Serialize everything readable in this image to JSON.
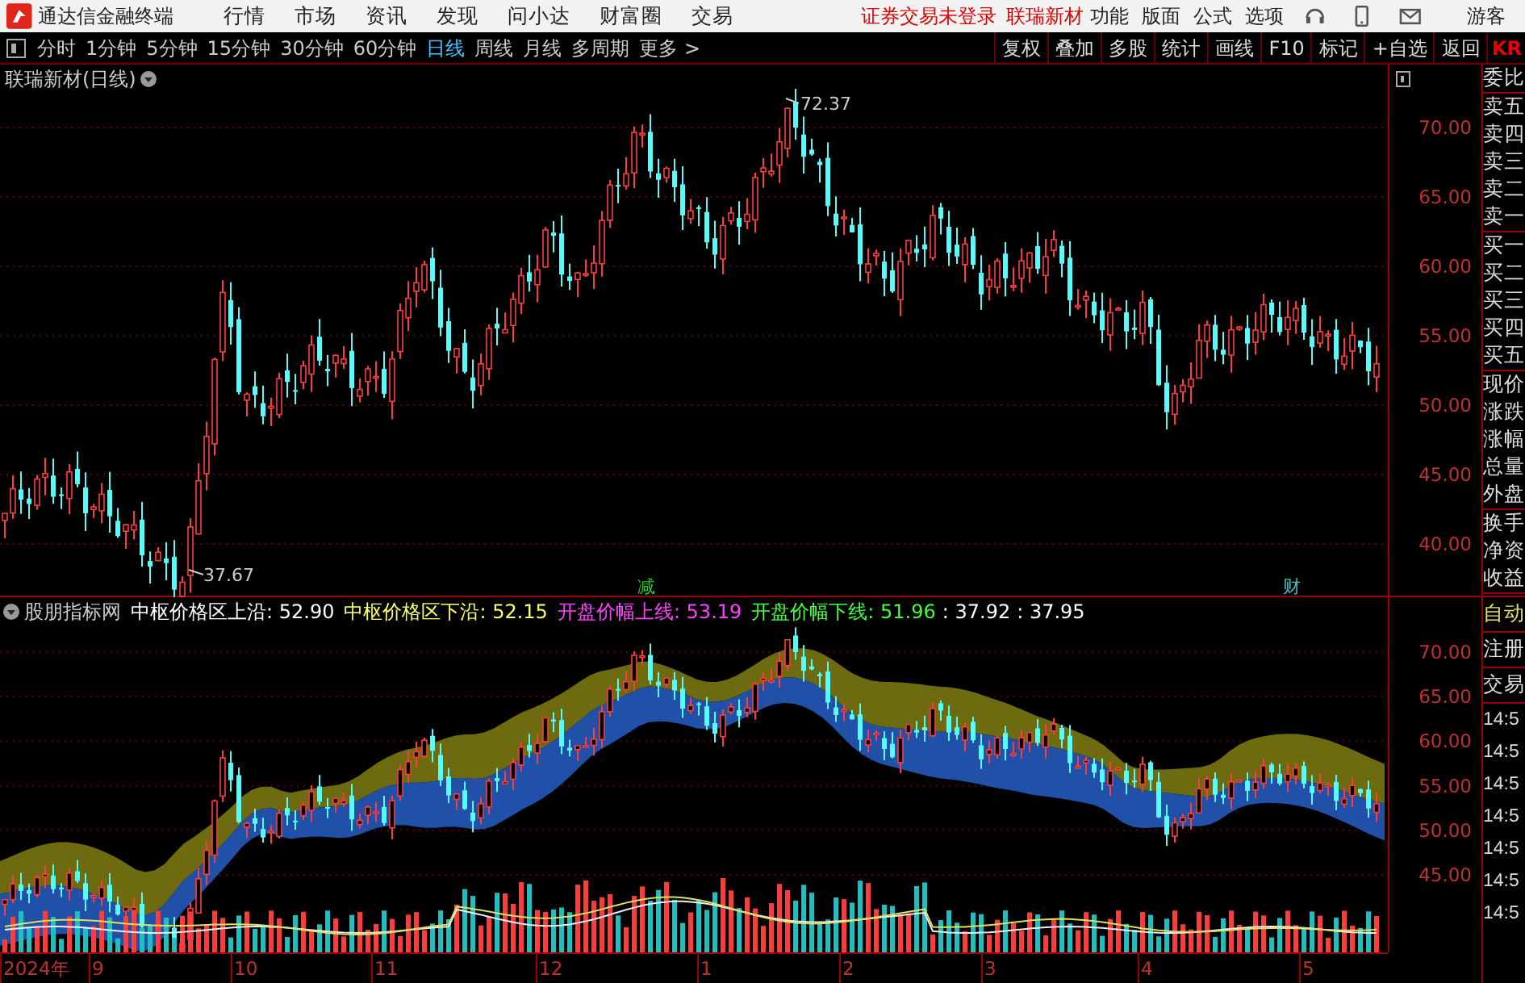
{
  "app": {
    "title": "通达信金融终端",
    "menu": [
      "行情",
      "市场",
      "资讯",
      "发现",
      "问小达",
      "财富圈",
      "交易"
    ],
    "notice": "证券交易未登录",
    "stock_link": "联瑞新材",
    "tools": [
      "功能",
      "版面",
      "公式",
      "选项"
    ],
    "user": "游客"
  },
  "periods": [
    {
      "label": "分时",
      "selected": false
    },
    {
      "label": "1分钟",
      "selected": false
    },
    {
      "label": "5分钟",
      "selected": false
    },
    {
      "label": "15分钟",
      "selected": false
    },
    {
      "label": "30分钟",
      "selected": false
    },
    {
      "label": "60分钟",
      "selected": false
    },
    {
      "label": "日线",
      "selected": true
    },
    {
      "label": "周线",
      "selected": false
    },
    {
      "label": "月线",
      "selected": false
    },
    {
      "label": "多周期",
      "selected": false
    },
    {
      "label": "更多 >",
      "selected": false
    }
  ],
  "actions": [
    "复权",
    "叠加",
    "多股",
    "统计",
    "画线",
    "F10",
    "标记",
    "+自选",
    "返回"
  ],
  "corner_code": "KR",
  "main_chart": {
    "title": "联瑞新材(日线)",
    "price_labels": [
      "70.00",
      "65.00",
      "60.00",
      "55.00",
      "50.00",
      "45.00",
      "40.00"
    ],
    "high_mark": "72.37",
    "low_mark": "37.67",
    "events": [
      {
        "text": "减",
        "color": "#30c030"
      },
      {
        "text": "财",
        "color": "#40c0c0"
      }
    ]
  },
  "indicator": {
    "source": "股朋指标网",
    "readings": [
      {
        "text": "中枢价格区上沿: 52.90",
        "color": "#ffffff"
      },
      {
        "text": "中枢价格区下沿: 52.15",
        "color": "#ffff66"
      },
      {
        "text": "开盘价幅上线: 53.19",
        "color": "#ff40ff"
      },
      {
        "text": "开盘价幅下线: 51.96",
        "color": "#40ff40"
      },
      {
        "text": ": 37.92",
        "color": "#ffffff"
      },
      {
        "text": ": 37.95",
        "color": "#ffffff"
      }
    ],
    "price_labels": [
      "70.00",
      "65.00",
      "60.00",
      "55.00",
      "50.00",
      "45.00"
    ]
  },
  "time_axis": [
    "2024年",
    "9",
    "10",
    "11",
    "12",
    "1",
    "2",
    "3",
    "4",
    "5"
  ],
  "quote_panel": {
    "groups": [
      [
        "委比"
      ],
      [
        "卖五",
        "卖四",
        "卖三",
        "卖二",
        "卖一"
      ],
      [
        "买一",
        "买二",
        "买三",
        "买四",
        "买五"
      ],
      [
        "现价",
        "涨跌",
        "涨幅",
        "总量",
        "外盘"
      ],
      [
        "换手",
        "净资",
        "收益"
      ]
    ],
    "trade_items": [
      "自动",
      "注册",
      "交易"
    ],
    "times": [
      "14:5",
      "14:5",
      "14:5",
      "14:5",
      "14:5",
      "14:5",
      "14:5"
    ]
  }
}
